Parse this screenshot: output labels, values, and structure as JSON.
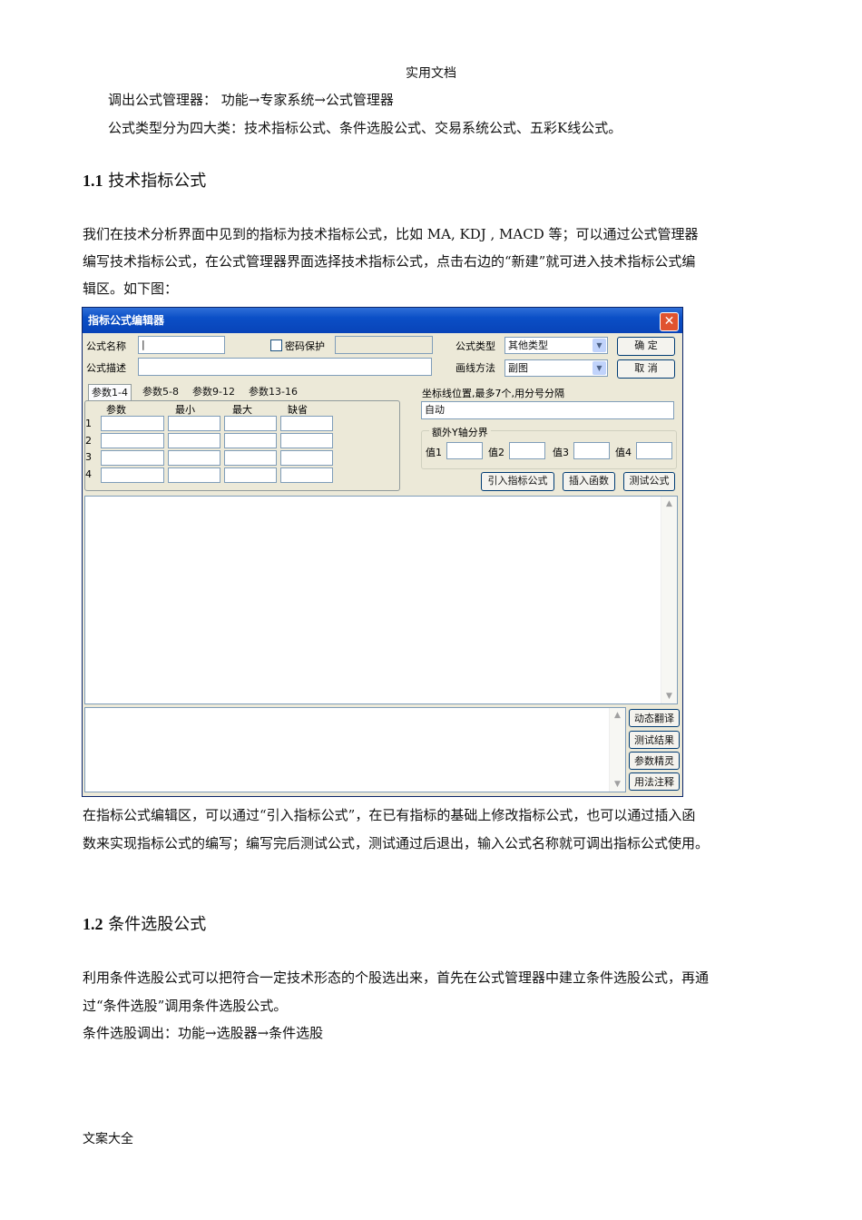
{
  "header": "实用文档",
  "intro": {
    "line1": "调出公式管理器：  功能→专家系统→公式管理器",
    "line2": "公式类型分为四大类：技术指标公式、条件选股公式、交易系统公式、五彩K线公式。"
  },
  "section1": {
    "num": "1.1",
    "title": "技术指标公式",
    "para": [
      "我们在技术分析界面中见到的指标为技术指标公式，比如 MA,   KDJ , MACD   等；可以通过公式管理器",
      "编写技术指标公式，在公式管理器界面选择技术指标公式，点击右边的“新建”就可进入技术指标公式编",
      "辑区。如下图："
    ],
    "after": [
      "在指标公式编辑区，可以通过“引入指标公式”，在已有指标的基础上修改指标公式，也可以通过插入函",
      "数来实现指标公式的编写；编写完后测试公式，测试通过后退出，输入公式名称就可调出指标公式使用。"
    ]
  },
  "dialog": {
    "title": "指标公式编辑器",
    "close": "✕",
    "name_label": "公式名称",
    "name_value": "|",
    "pwd_label": "密码保护",
    "type_label": "公式类型",
    "type_value": "其他类型",
    "ok": "确  定",
    "desc_label": "公式描述",
    "draw_label": "画线方法",
    "draw_value": "副图",
    "cancel": "取  消",
    "tabs": [
      "参数1-4",
      "参数5-8",
      "参数9-12",
      "参数13-16"
    ],
    "cols": [
      "参数",
      "最小",
      "最大",
      "缺省"
    ],
    "rows": [
      "1",
      "2",
      "3",
      "4"
    ],
    "coord_label": "坐标线位置,最多7个,用分号分隔",
    "coord_value": "自动",
    "ygroup": "额外Y轴分界",
    "vals": [
      "值1",
      "值2",
      "值3",
      "值4"
    ],
    "btn_import": "引入指标公式",
    "btn_insert": "插入函数",
    "btn_test": "测试公式",
    "side": [
      "动态翻译",
      "测试结果",
      "参数精灵",
      "用法注释"
    ]
  },
  "section2": {
    "num": "1.2",
    "title": "条件选股公式",
    "para": [
      "利用条件选股公式可以把符合一定技术形态的个股选出来，首先在公式管理器中建立条件选股公式，再通",
      "过“条件选股”调用条件选股公式。",
      "条件选股调出：功能→选股器→条件选股"
    ]
  },
  "footer": "文案大全"
}
